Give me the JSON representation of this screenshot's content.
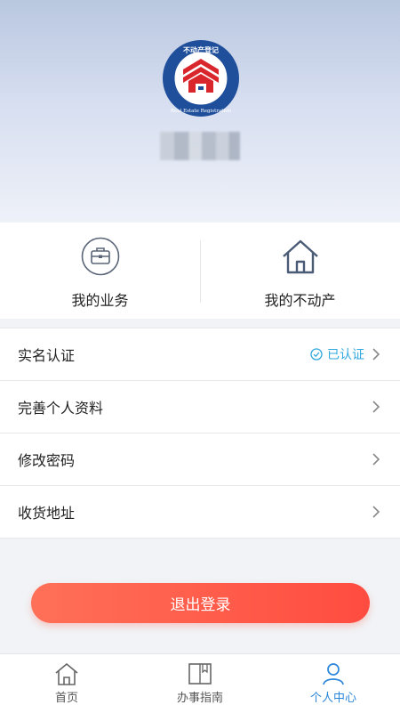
{
  "header": {
    "logo_text_top": "不动产登记",
    "logo_text_bottom": "Real Estate Registration"
  },
  "quick_actions": [
    {
      "label": "我的业务",
      "icon": "briefcase-icon"
    },
    {
      "label": "我的不动产",
      "icon": "house-icon"
    }
  ],
  "menu": [
    {
      "label": "实名认证",
      "status": "已认证",
      "status_icon": "check-circle-icon"
    },
    {
      "label": "完善个人资料"
    },
    {
      "label": "修改密码"
    },
    {
      "label": "收货地址"
    }
  ],
  "logout_label": "退出登录",
  "tabs": [
    {
      "label": "首页",
      "icon": "home-icon",
      "active": false
    },
    {
      "label": "办事指南",
      "icon": "book-icon",
      "active": false
    },
    {
      "label": "个人中心",
      "icon": "person-icon",
      "active": true
    }
  ],
  "colors": {
    "accent": "#2b86d9",
    "verified": "#2fa7df",
    "logout_start": "#ff7058",
    "logout_end": "#ff4c40"
  }
}
